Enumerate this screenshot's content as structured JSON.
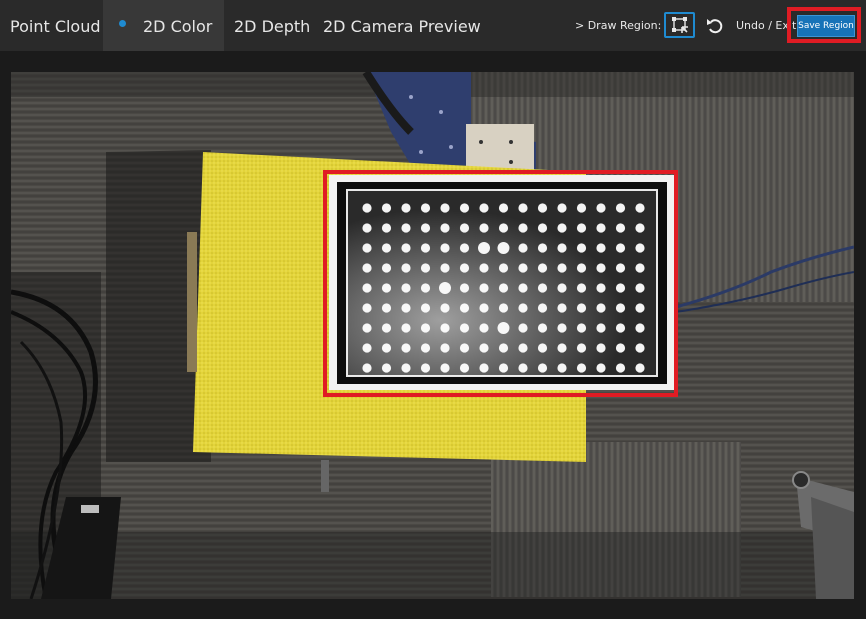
{
  "tabs": [
    {
      "label": "Point Cloud",
      "active": false
    },
    {
      "label": "2D Color",
      "active": true
    },
    {
      "label": "2D Depth",
      "active": false
    },
    {
      "label": "2D Camera Preview",
      "active": false
    }
  ],
  "toolbar": {
    "draw_region_label": "> Draw Region:",
    "draw_region_icon": "draw-region-icon",
    "undo_icon": "undo-icon",
    "undo_exit_label": "Undo / Exit",
    "save_region_label": "Save Region"
  },
  "colors": {
    "accent": "#1f8bd1",
    "highlight": "#e01c24",
    "save_button": "#1773b8",
    "topbar": "#2a2a2a",
    "active_tab": "#383838",
    "background": "#1b1b1b"
  },
  "image": {
    "description_icon": "camera-2d-color-image"
  }
}
